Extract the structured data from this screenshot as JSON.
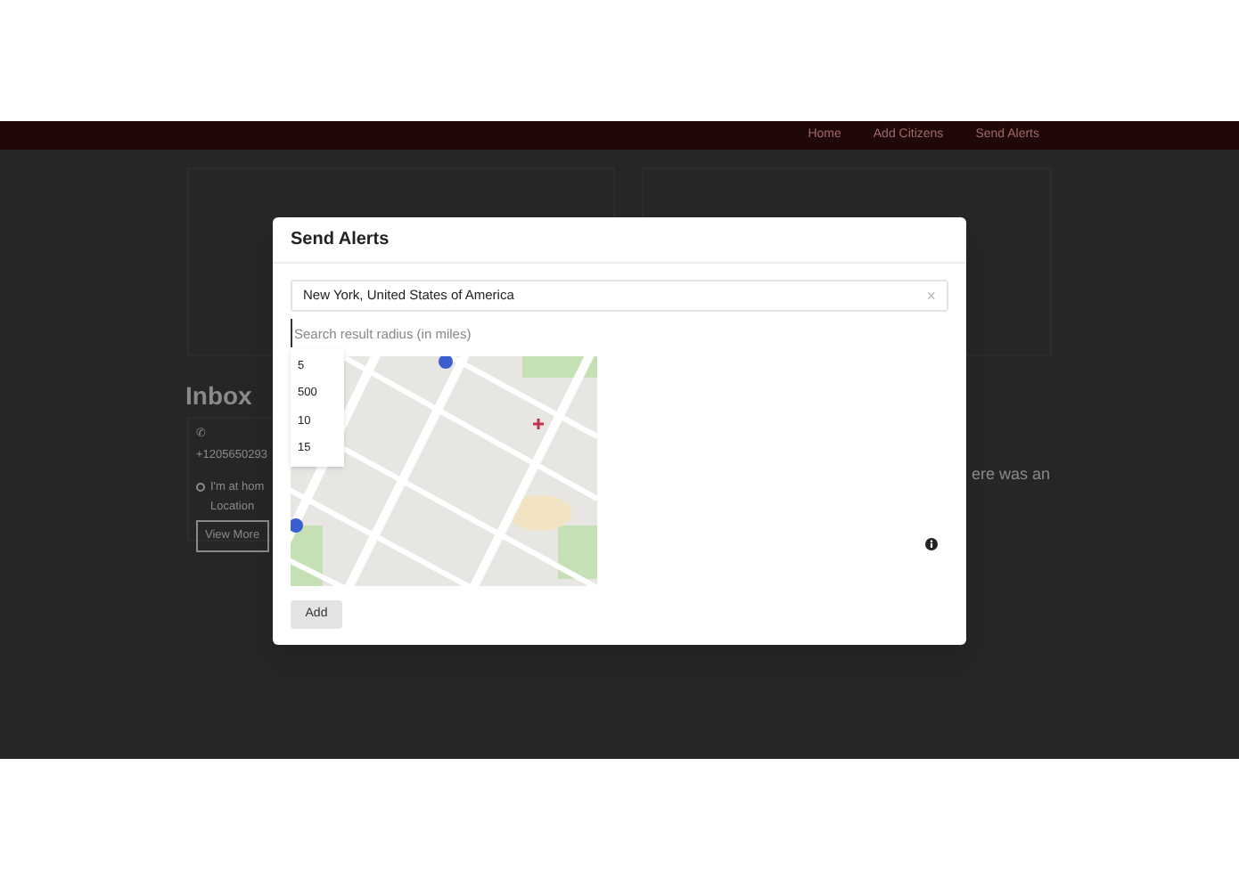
{
  "nav": {
    "links": [
      "Home",
      "Add Citizens",
      "Send Alerts"
    ]
  },
  "background": {
    "inbox_title": "Inbox",
    "phone_icon": "✆",
    "phone": "+1205650293",
    "message": "I'm at hom",
    "location": "Location",
    "view_more": "View More",
    "side_text": "ere was an"
  },
  "modal": {
    "title": "Send Alerts",
    "location_field": {
      "value": "New York, United States of America",
      "clear": "×"
    },
    "radius_field": {
      "placeholder": "Search result radius (in miles)"
    },
    "radius_options": [
      "5",
      "500",
      "10",
      "15"
    ],
    "add_button": "Add"
  }
}
